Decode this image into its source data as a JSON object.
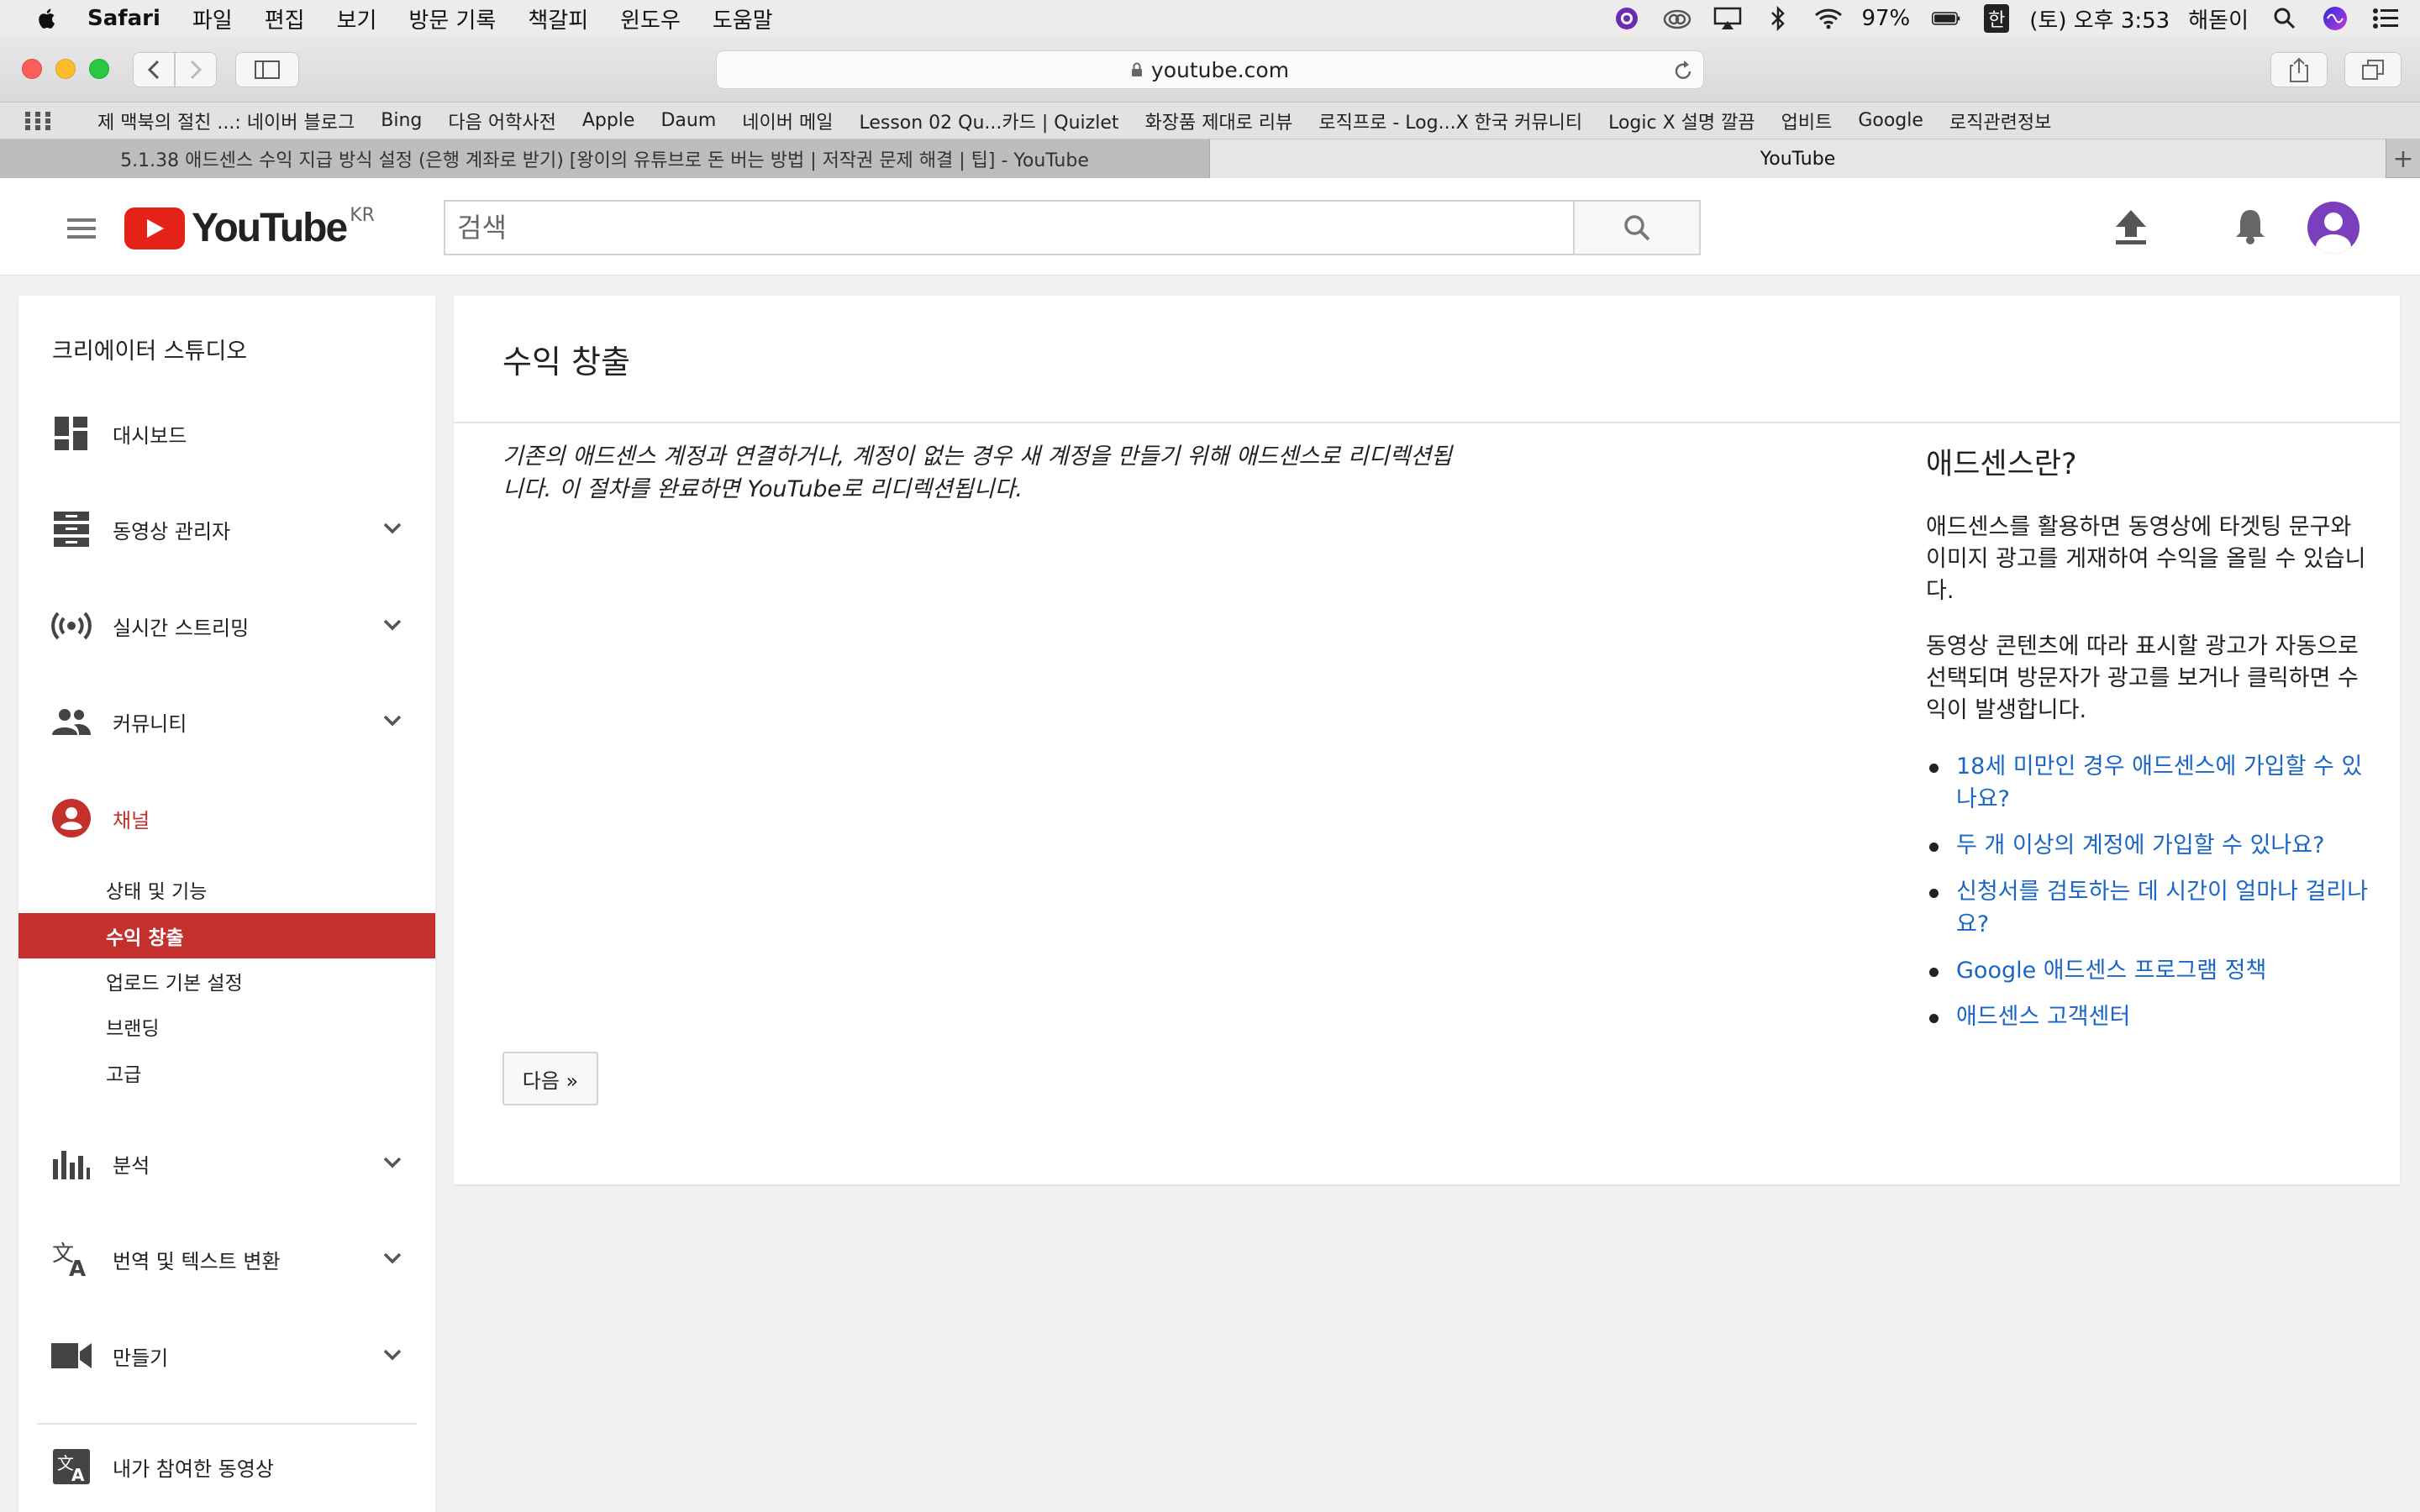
{
  "menubar": {
    "items": [
      "Safari",
      "파일",
      "편집",
      "보기",
      "방문 기록",
      "책갈피",
      "윈도우",
      "도움말"
    ],
    "battery": "97%",
    "input_method": "한",
    "clock": "(토) 오후 3:53",
    "user": "해돋이"
  },
  "toolbar": {
    "url": "youtube.com"
  },
  "bookmarks": [
    "제 맥북의 절친 ...: 네이버 블로그",
    "Bing",
    "다음 어학사전",
    "Apple",
    "Daum",
    "네이버 메일",
    "Lesson 02 Qu...카드 | Quizlet",
    "화장품 제대로 리뷰",
    "로직프로 - Log...X 한국 커뮤니티",
    "Logic X 설명 깔끔",
    "업비트",
    "Google",
    "로직관련정보"
  ],
  "tabs": [
    {
      "label": "5.1.38 애드센스 수익 지급 방식 설정 (은행 계좌로 받기) [왕이의 유튜브로 돈 버는 방법 | 저작권 문제 해결 | 팁] - YouTube"
    },
    {
      "label": "YouTube"
    }
  ],
  "header": {
    "logo_text": "YouTube",
    "region": "KR",
    "search_placeholder": "검색"
  },
  "sidebar": {
    "title": "크리에이터 스튜디오",
    "items": [
      {
        "label": "대시보드"
      },
      {
        "label": "동영상 관리자"
      },
      {
        "label": "실시간 스트리밍"
      },
      {
        "label": "커뮤니티"
      },
      {
        "label": "채널"
      },
      {
        "label": "분석"
      },
      {
        "label": "번역 및 텍스트 변환"
      },
      {
        "label": "만들기"
      },
      {
        "label": "내가 참여한 동영상"
      }
    ],
    "channel_sub": [
      {
        "label": "상태 및 기능"
      },
      {
        "label": "수익 창출"
      },
      {
        "label": "업로드 기본 설정"
      },
      {
        "label": "브랜딩"
      },
      {
        "label": "고급"
      }
    ]
  },
  "main": {
    "title": "수익 창출",
    "intro": "기존의 애드센스 계정과 연결하거나, 계정이 없는 경우 새 계정을 만들기 위해 애드센스로 리디렉션됩니다. 이 절차를 완료하면 YouTube로 리디렉션됩니다.",
    "next_button": "다음 »",
    "aside": {
      "heading": "애드센스란?",
      "paragraphs": [
        "애드센스를 활용하면 동영상에 타겟팅 문구와 이미지 광고를 게재하여 수익을 올릴 수 있습니다.",
        "동영상 콘텐츠에 따라 표시할 광고가 자동으로 선택되며 방문자가 광고를 보거나 클릭하면 수익이 발생합니다."
      ],
      "links": [
        "18세 미만인 경우 애드센스에 가입할 수 있나요?",
        "두 개 이상의 계정에 가입할 수 있나요?",
        "신청서를 검토하는 데 시간이 얼마나 걸리나요?",
        "Google 애드센스 프로그램 정책",
        "애드센스 고객센터"
      ]
    }
  },
  "colors": {
    "accent": "#c4302b",
    "link": "#1a66c7",
    "youtube_red": "#e62117"
  }
}
